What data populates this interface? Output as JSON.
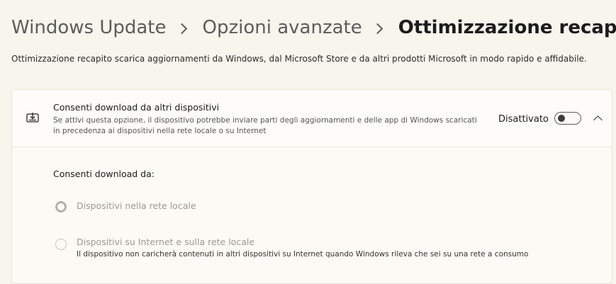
{
  "breadcrumb": {
    "items": [
      "Windows Update",
      "Opzioni avanzate"
    ],
    "current": "Ottimizzazione recapito"
  },
  "page": {
    "description": "Ottimizzazione recapito scarica aggiornamenti da Windows, dal Microsoft Store e da altri prodotti Microsoft in modo rapido e affidabile."
  },
  "setting": {
    "icon": "download-devices-icon",
    "title": "Consenti download da altri dispositivi",
    "description": "Se attivi questa opzione, il dispositivo potrebbe inviare parti degli aggiornamenti e delle app di Windows scaricati in precedenza ai dispositivi nella rete locale o su Internet",
    "state_label": "Disattivato",
    "toggle_on": false,
    "expanded": true
  },
  "download_from": {
    "label": "Consenti download da:",
    "options": [
      {
        "label": "Dispositivi nella rete locale",
        "selected": true,
        "enabled": false
      },
      {
        "label": "Dispositivi su Internet e sulla rete locale",
        "note": "Il dispositivo non caricherà contenuti in altri dispositivi su Internet quando Windows rileva che sei su una rete a consumo",
        "selected": false,
        "enabled": false
      }
    ]
  }
}
